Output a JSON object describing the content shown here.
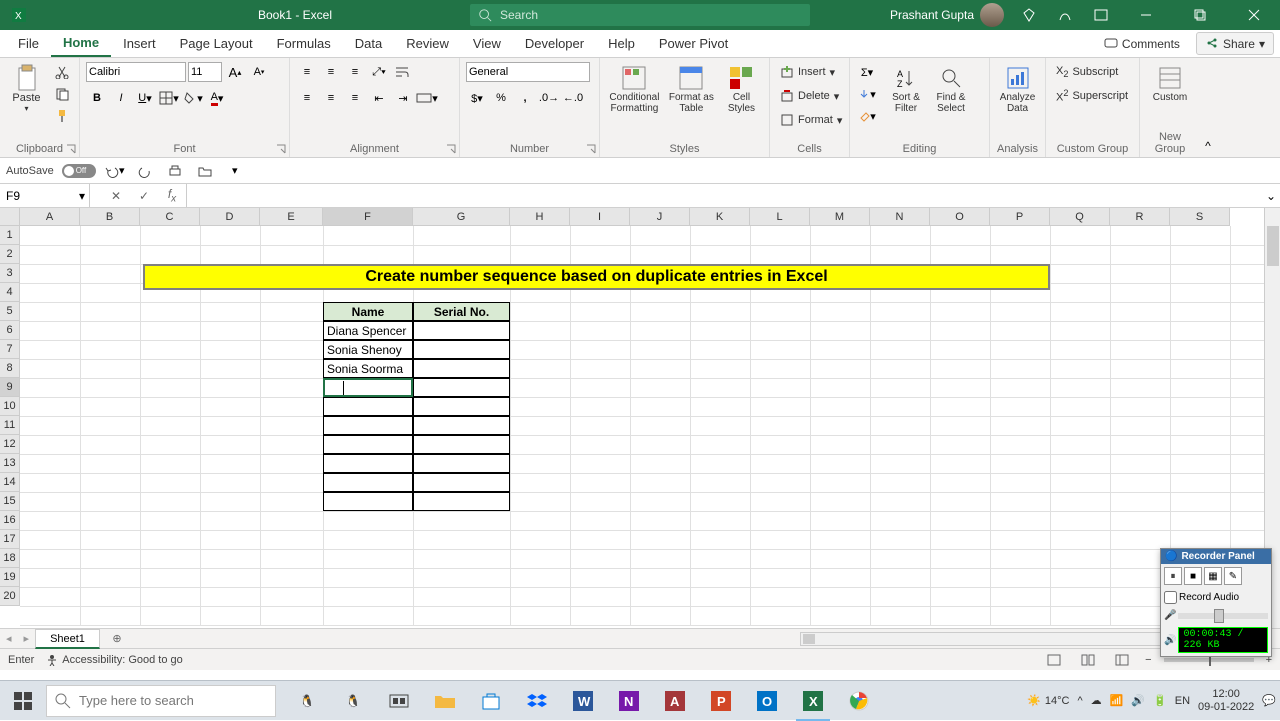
{
  "title_bar": {
    "document": "Book1 - Excel",
    "search_placeholder": "Search",
    "user_name": "Prashant Gupta"
  },
  "tabs": {
    "file": "File",
    "home": "Home",
    "insert": "Insert",
    "page_layout": "Page Layout",
    "formulas": "Formulas",
    "data": "Data",
    "review": "Review",
    "view": "View",
    "developer": "Developer",
    "help": "Help",
    "power_pivot": "Power Pivot",
    "comments": "Comments",
    "share": "Share"
  },
  "ribbon": {
    "paste": "Paste",
    "font_name": "Calibri",
    "font_size": "11",
    "number_format": "General",
    "cond_fmt": "Conditional Formatting",
    "fmt_table": "Format as Table",
    "cell_styles": "Cell Styles",
    "insert": "Insert",
    "delete": "Delete",
    "format": "Format",
    "sort_filter": "Sort & Filter",
    "find_select": "Find & Select",
    "analyze": "Analyze Data",
    "subscript": "Subscript",
    "superscript": "Superscript",
    "custom": "Custom",
    "groups": {
      "clipboard": "Clipboard",
      "font": "Font",
      "alignment": "Alignment",
      "number": "Number",
      "styles": "Styles",
      "cells": "Cells",
      "editing": "Editing",
      "analysis": "Analysis",
      "custom_group": "Custom Group",
      "new_group": "New Group"
    }
  },
  "qat": {
    "autosave": "AutoSave",
    "autosave_state": "Off"
  },
  "namebox": "F9",
  "formula": "",
  "columns": [
    "A",
    "B",
    "C",
    "D",
    "E",
    "F",
    "G",
    "H",
    "I",
    "J",
    "K",
    "L",
    "M",
    "N",
    "O",
    "P",
    "Q",
    "R",
    "S"
  ],
  "rows": [
    1,
    2,
    3,
    4,
    5,
    6,
    7,
    8,
    9,
    10,
    11,
    12,
    13,
    14,
    15,
    16,
    17,
    18,
    19,
    20
  ],
  "banner_text": "Create number sequence based on duplicate entries in Excel",
  "table": {
    "headers": {
      "name": "Name",
      "serial": "Serial No."
    },
    "rows": [
      "Diana Spencer",
      "Sonia Shenoy",
      "Sonia Soorma",
      "",
      "",
      "",
      "",
      "",
      "",
      ""
    ]
  },
  "sheet_tab": "Sheet1",
  "status": {
    "mode": "Enter",
    "accessibility": "Accessibility: Good to go",
    "zoom": "100%"
  },
  "recorder": {
    "title": "Recorder Panel",
    "record_audio": "Record Audio",
    "timer": "00:00:43 / 226 KB"
  },
  "taskbar": {
    "search_placeholder": "Type here to search",
    "weather": "14°C",
    "time": "12:00",
    "date": "09-01-2022",
    "lang": "EN"
  }
}
